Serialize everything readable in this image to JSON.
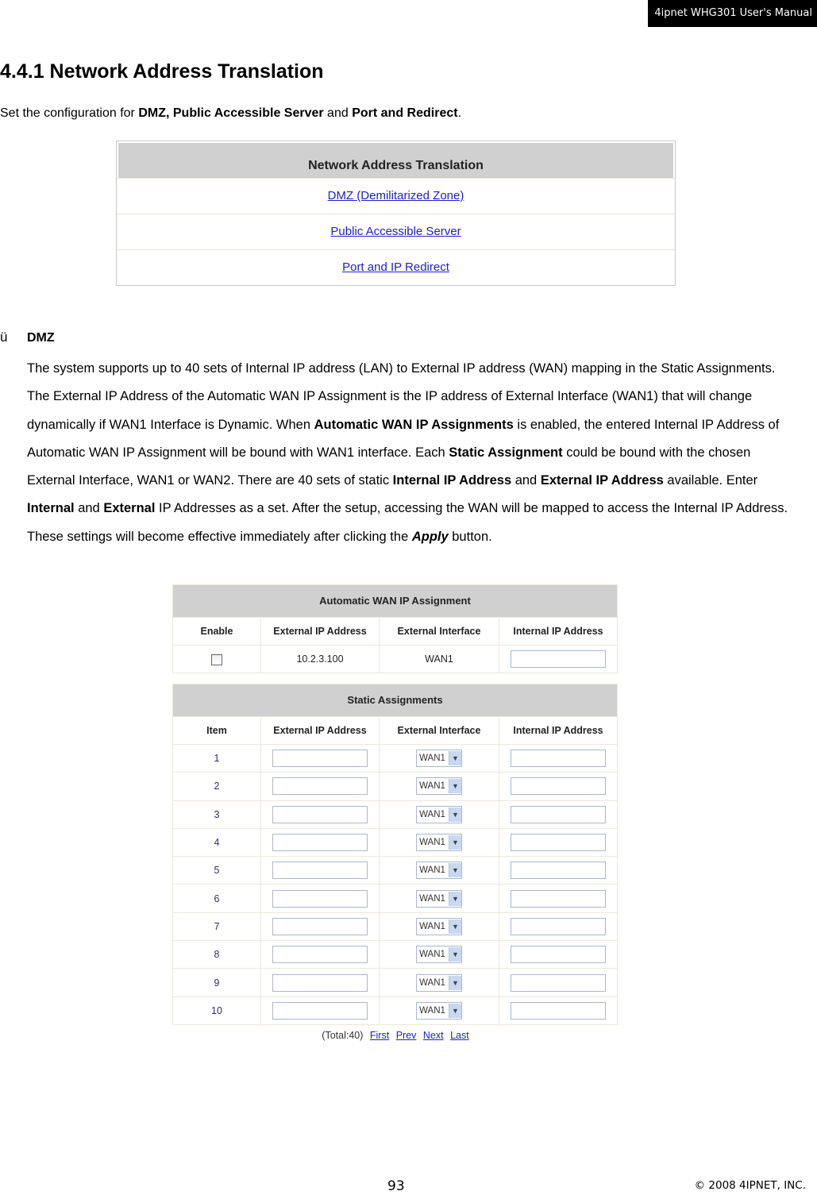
{
  "header": {
    "manual_tag": "4ipnet WHG301 User's Manual"
  },
  "section": {
    "title": "4.4.1 Network Address Translation",
    "intro": {
      "prefix": "Set the configuration for ",
      "bold1": "DMZ, Public Accessible Server",
      "mid": " and ",
      "bold2": "Port and Redirect",
      "suffix": "."
    }
  },
  "nat_menu": {
    "title": "Network Address Translation",
    "links": [
      "DMZ (Demilitarized Zone)",
      "Public Accessible Server",
      "Port and IP Redirect"
    ]
  },
  "dmz": {
    "bullet": "ü",
    "title": "DMZ",
    "paragraph": [
      {
        "t": "The system supports up to 40 sets of Internal IP address (LAN) to External IP address (WAN) mapping in the Static Assignments. The External IP Address of the Automatic WAN IP Assignment is the IP address of External Interface (WAN1) that will change dynamically if WAN1 Interface is Dynamic. When ",
        "b": false,
        "i": false
      },
      {
        "t": "Automatic WAN IP Assignments",
        "b": true,
        "i": false
      },
      {
        "t": " is enabled, the entered Internal IP Address of Automatic WAN IP Assignment will be bound with WAN1 interface. Each ",
        "b": false,
        "i": false
      },
      {
        "t": "Static Assignment",
        "b": true,
        "i": false
      },
      {
        "t": " could be bound with the chosen External Interface, WAN1 or WAN2. There are 40 sets of static ",
        "b": false,
        "i": false
      },
      {
        "t": "Internal IP Address",
        "b": true,
        "i": false
      },
      {
        "t": " and ",
        "b": false,
        "i": false
      },
      {
        "t": "External IP Address",
        "b": true,
        "i": false
      },
      {
        "t": " available. Enter ",
        "b": false,
        "i": false
      },
      {
        "t": "Internal",
        "b": true,
        "i": false
      },
      {
        "t": " and ",
        "b": false,
        "i": false
      },
      {
        "t": "External",
        "b": true,
        "i": false
      },
      {
        "t": " IP Addresses as a set. After the setup, accessing the WAN will be mapped to access the Internal IP Address. These settings will become effective immediately after clicking the ",
        "b": false,
        "i": false
      },
      {
        "t": "Apply",
        "b": true,
        "i": true
      },
      {
        "t": " button.",
        "b": false,
        "i": false
      }
    ]
  },
  "auto_wan": {
    "title": "Automatic WAN IP Assignment",
    "columns": [
      "Enable",
      "External IP Address",
      "External Interface",
      "Internal IP Address"
    ],
    "row": {
      "enabled": false,
      "external_ip": "10.2.3.100",
      "interface": "WAN1",
      "internal_ip": ""
    }
  },
  "static": {
    "title": "Static Assignments",
    "columns": [
      "Item",
      "External IP Address",
      "External Interface",
      "Internal IP Address"
    ],
    "rows": [
      {
        "item": "1",
        "external_ip": "",
        "interface": "WAN1",
        "internal_ip": ""
      },
      {
        "item": "2",
        "external_ip": "",
        "interface": "WAN1",
        "internal_ip": ""
      },
      {
        "item": "3",
        "external_ip": "",
        "interface": "WAN1",
        "internal_ip": ""
      },
      {
        "item": "4",
        "external_ip": "",
        "interface": "WAN1",
        "internal_ip": ""
      },
      {
        "item": "5",
        "external_ip": "",
        "interface": "WAN1",
        "internal_ip": ""
      },
      {
        "item": "6",
        "external_ip": "",
        "interface": "WAN1",
        "internal_ip": ""
      },
      {
        "item": "7",
        "external_ip": "",
        "interface": "WAN1",
        "internal_ip": ""
      },
      {
        "item": "8",
        "external_ip": "",
        "interface": "WAN1",
        "internal_ip": ""
      },
      {
        "item": "9",
        "external_ip": "",
        "interface": "WAN1",
        "internal_ip": ""
      },
      {
        "item": "10",
        "external_ip": "",
        "interface": "WAN1",
        "internal_ip": ""
      }
    ]
  },
  "pager": {
    "total": "(Total:40)",
    "first": "First",
    "prev": "Prev",
    "next": "Next",
    "last": "Last"
  },
  "footer": {
    "page_number": "93",
    "copyright": "© 2008 4IPNET, INC."
  }
}
